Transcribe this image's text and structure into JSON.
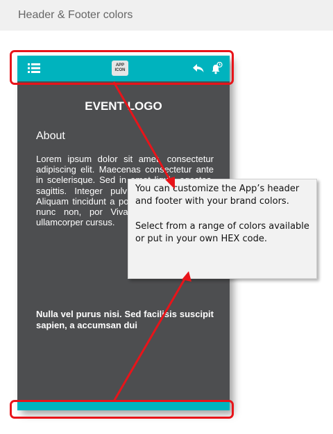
{
  "page": {
    "title": "Header & Footer colors"
  },
  "app": {
    "header": {
      "app_icon_line1": "APP",
      "app_icon_line2": "ICON",
      "color": "#00b3be"
    },
    "event_logo": "EVENT LOGO",
    "section_title": "About",
    "body": "Lorem ipsum dolor sit amet, consectetur adipiscing elit. Maecenas consectetur ante in scelerisque. Sed in amet ligula egestas, sagittis. Integer pulv feugiat, ut ultricie Aliquam tincidunt a posuere. Quisque m ut nunc non, por Vivamus mollis nisi ut ullamcorper cursus.",
    "bold_body": "Nulla vel purus nisi. Sed facilisis suscipit sapien, a accumsan dui",
    "footer": {
      "color": "#00b3be"
    }
  },
  "callout": {
    "line1": "You can customize the App’s header and footer with your brand colors.",
    "line2": "Select from a range of colors available  or put in your own HEX code."
  },
  "colors": {
    "highlight": "#e8141a",
    "phone_bg": "#4d4e50"
  }
}
